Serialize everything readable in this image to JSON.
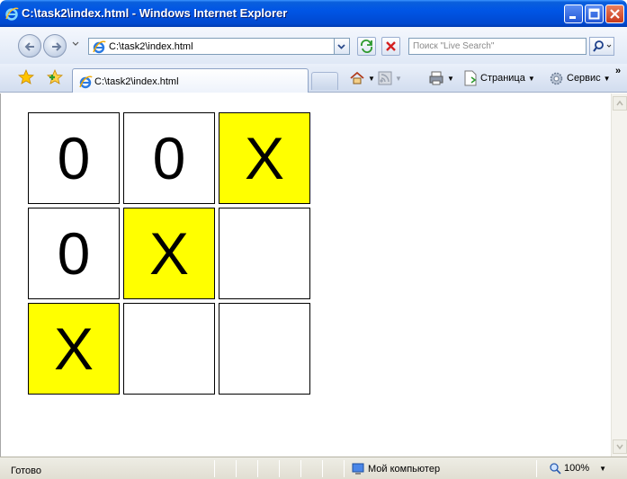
{
  "window": {
    "title": "C:\\task2\\index.html - Windows Internet Explorer"
  },
  "address_bar": {
    "url": "C:\\task2\\index.html",
    "search_placeholder": "Поиск \"Live Search\""
  },
  "tab": {
    "label": "C:\\task2\\index.html"
  },
  "command_bar": {
    "page_label": "Страница",
    "tools_label": "Сервис",
    "more_label": "»"
  },
  "board": {
    "rows": [
      [
        {
          "mark": "0",
          "highlight": false
        },
        {
          "mark": "0",
          "highlight": false
        },
        {
          "mark": "X",
          "highlight": true
        }
      ],
      [
        {
          "mark": "0",
          "highlight": false
        },
        {
          "mark": "X",
          "highlight": true
        },
        {
          "mark": "",
          "highlight": false
        }
      ],
      [
        {
          "mark": "X",
          "highlight": true
        },
        {
          "mark": "",
          "highlight": false
        },
        {
          "mark": "",
          "highlight": false
        }
      ]
    ],
    "highlight_color": "#ffff00"
  },
  "status_bar": {
    "status": "Готово",
    "zone": "Мой компьютер",
    "zoom": "100%"
  },
  "colors": {
    "title_bar": "#0055e5",
    "x_cell": "#ffff00"
  },
  "icons": {
    "browser": "ie-logo-icon",
    "back": "back-arrow-icon",
    "forward": "forward-arrow-icon",
    "refresh": "refresh-icon",
    "stop": "stop-icon",
    "search": "search-icon",
    "favorites": "favorites-star-icon",
    "add_favorite": "add-favorite-icon",
    "home": "home-icon",
    "feeds": "feeds-icon",
    "print": "print-icon",
    "page": "page-icon",
    "tools": "tools-gear-icon",
    "zone": "my-computer-icon",
    "zoom": "zoom-icon"
  }
}
